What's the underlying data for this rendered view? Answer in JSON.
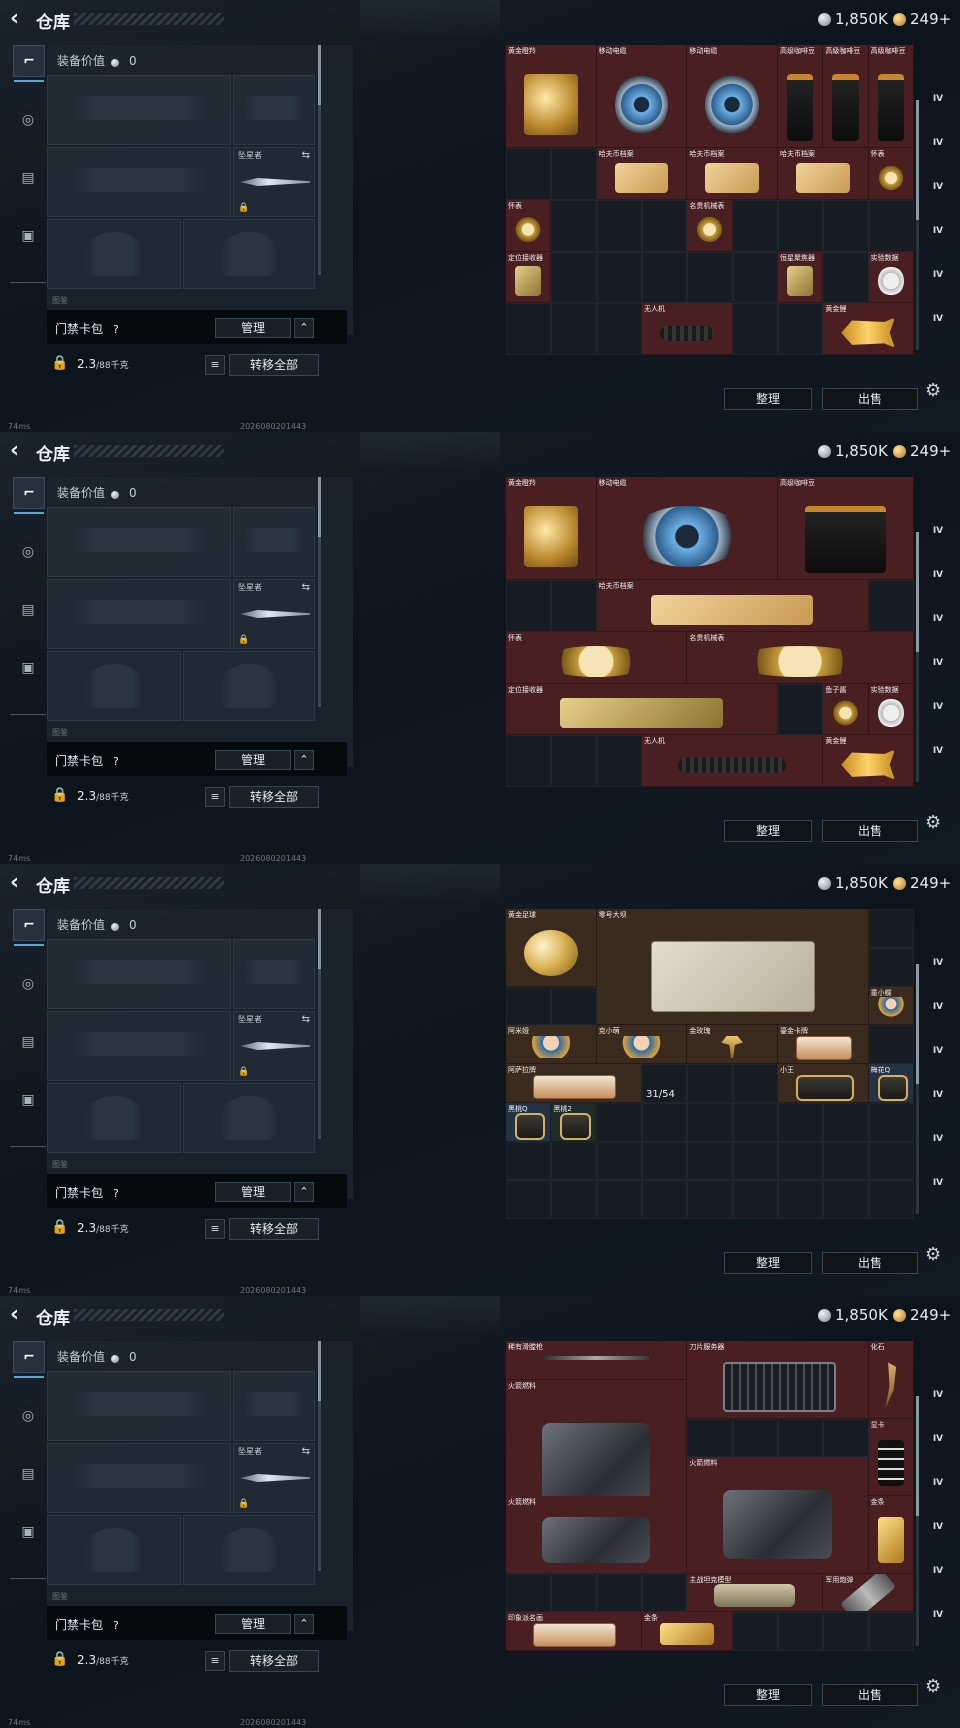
{
  "common": {
    "title": "仓库",
    "currency1": "1,850K",
    "currency2": "249+",
    "equip_value_label": "装备价值",
    "equip_value": "0",
    "knife_label": "坠星者",
    "bag_label": "门禁卡包",
    "bag_help": "?",
    "manage_label": "管理",
    "weight_value": "2.3",
    "weight_unit": "/88千克",
    "transfer_label": "转移全部",
    "sort_label": "整理",
    "sell_label": "出售",
    "ping": "74ms",
    "version": "2026080201443",
    "note": "图鉴",
    "rail": [
      "",
      "IV",
      "IV",
      "IV",
      "IV",
      "IV",
      "IV"
    ]
  },
  "screens": [
    {
      "cells": [
        {
          "name": "黄金瞪羚",
          "color": "red",
          "icon": "gold"
        },
        {
          "name": "移动电缆",
          "color": "red",
          "icon": "reel"
        },
        {
          "name": "移动电缆",
          "color": "red",
          "icon": "reel"
        },
        {
          "name": "高级咖啡豆",
          "color": "red",
          "icon": "coffee"
        },
        {
          "name": "高级咖啡豆",
          "color": "red",
          "icon": "coffee"
        },
        {
          "name": "高级咖啡豆",
          "color": "red",
          "icon": "coffee"
        },
        {
          "name": "哈夫币档案",
          "color": "red",
          "icon": "file"
        },
        {
          "name": "哈夫币档案",
          "color": "red",
          "icon": "file"
        },
        {
          "name": "哈夫币档案",
          "color": "red",
          "icon": "file"
        },
        {
          "name": "怀表",
          "color": "red",
          "icon": "watch"
        },
        {
          "name": "怀表",
          "color": "red",
          "icon": "watch"
        },
        {
          "name": "名贵机械表",
          "color": "red",
          "icon": "watch"
        },
        {
          "name": "定位接收器",
          "color": "red",
          "icon": "chip"
        },
        {
          "name": "恒星聚焦器",
          "color": "red",
          "icon": "chip"
        },
        {
          "name": "实验数据",
          "color": "red",
          "icon": "disc"
        },
        {
          "name": "无人机",
          "color": "red",
          "icon": "drone"
        },
        {
          "name": "黄金鲤",
          "color": "red",
          "icon": "fish"
        }
      ]
    },
    {
      "cells": [
        {
          "name": "黄金瞪羚",
          "color": "red",
          "icon": "gold"
        },
        {
          "name": "移动电缆",
          "color": "red",
          "icon": "reel"
        },
        {
          "name": "高级咖啡豆",
          "color": "red",
          "icon": "coffee"
        },
        {
          "name": "哈夫币档案",
          "color": "red",
          "icon": "file"
        },
        {
          "name": "怀表",
          "color": "red",
          "icon": "watch"
        },
        {
          "name": "名贵机械表",
          "color": "red",
          "icon": "watch"
        },
        {
          "name": "定位接收器",
          "color": "red",
          "icon": "chip"
        },
        {
          "name": "鱼子酱",
          "color": "red",
          "icon": "watch"
        },
        {
          "name": "实验数据",
          "color": "red",
          "icon": "disc"
        },
        {
          "name": "无人机",
          "color": "red",
          "icon": "drone"
        },
        {
          "name": "黄金鲤",
          "color": "red",
          "icon": "fish"
        }
      ]
    },
    {
      "cells": [
        {
          "name": "黄金足球",
          "color": "brown",
          "icon": "ball"
        },
        {
          "name": "零号大坝",
          "color": "brown",
          "icon": "map"
        },
        {
          "name": "童小蝶",
          "color": "brown",
          "icon": "toy"
        },
        {
          "name": "阿米娅",
          "color": "brown",
          "icon": "toy"
        },
        {
          "name": "克小萌",
          "color": "brown",
          "icon": "toy"
        },
        {
          "name": "金玫瑰",
          "color": "brown",
          "icon": "rose"
        },
        {
          "name": "鎏金卡牌",
          "color": "brown",
          "icon": "card"
        },
        {
          "name": "阿萨拉牌",
          "color": "brown",
          "icon": "card"
        },
        {
          "name": "小王",
          "color": "brown",
          "icon": "keycard"
        },
        {
          "name": "梅花Q",
          "color": "blue",
          "icon": "keycard"
        },
        {
          "name": "黑桃Q",
          "color": "blue",
          "icon": "keycard"
        },
        {
          "name": "黑桃2",
          "color": "green",
          "icon": "keycard"
        }
      ],
      "counter": "31/54"
    },
    {
      "cells": [
        {
          "name": "稀有滑膛枪",
          "color": "red",
          "icon": "rifle"
        },
        {
          "name": "刀片服务器",
          "color": "red",
          "icon": "server"
        },
        {
          "name": "化石",
          "color": "red",
          "icon": "claw"
        },
        {
          "name": "火箭燃料",
          "color": "red",
          "icon": "can"
        },
        {
          "name": "显卡",
          "color": "red",
          "icon": "gpu"
        },
        {
          "name": "火箭燃料",
          "color": "red",
          "icon": "can"
        },
        {
          "name": "金条",
          "color": "red",
          "icon": "bar"
        },
        {
          "name": "火箭燃料",
          "color": "red",
          "icon": "can"
        },
        {
          "name": "主战坦克模型",
          "color": "red",
          "icon": "tank"
        },
        {
          "name": "军用炮弹",
          "color": "red",
          "icon": "shell"
        },
        {
          "name": "印象派名画",
          "color": "red",
          "icon": "card"
        },
        {
          "name": "金条",
          "color": "red",
          "icon": "bar"
        }
      ]
    }
  ]
}
